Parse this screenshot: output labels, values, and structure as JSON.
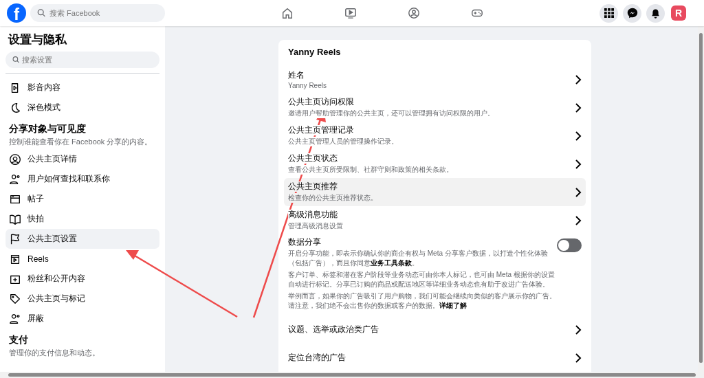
{
  "topbar": {
    "logo": "f",
    "search": {
      "placeholder": "搜索 Facebook"
    },
    "avatar": "R"
  },
  "sidebar": {
    "title": "设置与隐私",
    "search": {
      "placeholder": "搜索设置"
    },
    "groups": [
      {
        "items": [
          {
            "label": "影音内容",
            "selected": false
          },
          {
            "label": "深色模式",
            "selected": false
          }
        ]
      },
      {
        "heading": "分享对象与可见度",
        "description": "控制谁能查看你在 Facebook 分享的内容。",
        "items": [
          {
            "label": "公共主页详情",
            "selected": false
          },
          {
            "label": "用户如何查找和联系你",
            "selected": false
          },
          {
            "label": "帖子",
            "selected": false
          },
          {
            "label": "快拍",
            "selected": false
          },
          {
            "label": "公共主页设置",
            "selected": true
          },
          {
            "label": "Reels",
            "selected": false
          },
          {
            "label": "粉丝和公开内容",
            "selected": false
          },
          {
            "label": "公共主页与标记",
            "selected": false
          },
          {
            "label": "屏蔽",
            "selected": false
          }
        ]
      },
      {
        "heading": "支付",
        "description": "管理你的支付信息和动态。"
      }
    ]
  },
  "card": {
    "title": "Yanny Reels",
    "rows": [
      {
        "kind": "link",
        "title": "姓名",
        "subtitle": "Yanny Reels",
        "selected": false
      },
      {
        "kind": "link",
        "title": "公共主页访问权限",
        "subtitle": "邀请用户帮助管理你的公共主页，还可以管理拥有访问权限的用户。",
        "selected": false
      },
      {
        "kind": "link",
        "title": "公共主页管理记录",
        "subtitle": "公共主页管理人员的管理操作记录。",
        "selected": false
      },
      {
        "kind": "link",
        "title": "公共主页状态",
        "subtitle": "查看公共主页所受限制、社群守则和政策的相关条款。",
        "selected": false
      },
      {
        "kind": "link",
        "title": "公共主页推荐",
        "subtitle": "检查你的公共主页推荐状态。",
        "selected": true
      },
      {
        "kind": "link",
        "title": "高级消息功能",
        "subtitle": "管理高级消息设置",
        "selected": false
      },
      {
        "kind": "toggle",
        "title": "数据分享",
        "on": false,
        "paragraphs": [
          "开启分享功能，即表示你确认你的商企有权与 Meta 分享客户数据，以打造个性化体验（包括广告），而且你同意**业务工具条款**。",
          "客户订单、标签和潜在客户阶段等业务动态可由你本人标记，也可由 Meta 根据你的设置自动进行标记。分享已订购的商品或配送地区等详细业务动态也有助于改进广告体验。",
          "举例而言，如果你的广告吸引了用户购物，我们可能会继续向类似的客户展示你的广告。请注意，我们绝不会出售你的数据或客户的数据。**详细了解**"
        ]
      },
      {
        "kind": "link",
        "title": "议题、选举或政治类广告",
        "selected": false
      },
      {
        "kind": "link",
        "title": "定位台湾的广告",
        "selected": false
      }
    ]
  }
}
